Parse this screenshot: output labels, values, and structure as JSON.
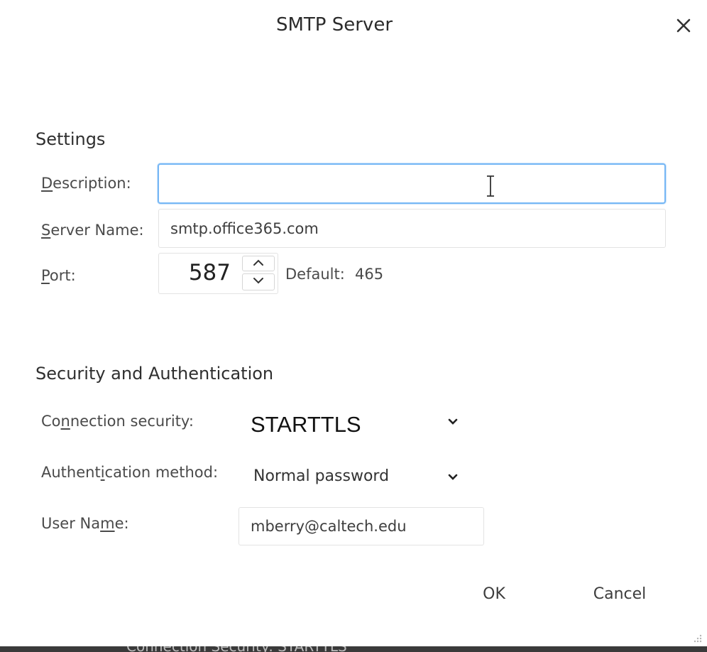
{
  "dialog": {
    "title": "SMTP Server",
    "close_icon": "close-icon"
  },
  "settings": {
    "heading": "Settings",
    "description": {
      "label_mnemonic": "D",
      "label_rest": "escription:",
      "value": ""
    },
    "server_name": {
      "label_mnemonic": "S",
      "label_rest": "erver Name:",
      "value": "smtp.office365.com"
    },
    "port": {
      "label_mnemonic": "P",
      "label_rest": "ort:",
      "value": "587",
      "default_label": "Default:",
      "default_value": "465"
    }
  },
  "security": {
    "heading": "Security and Authentication",
    "connection_security": {
      "label_pre": "Co",
      "label_mnemonic": "n",
      "label_post": "nection security:",
      "value": "STARTTLS"
    },
    "auth_method": {
      "label_pre": "Authent",
      "label_mnemonic": "i",
      "label_post": "cation method:",
      "value": "Normal password"
    },
    "user_name": {
      "label_pre": "User Na",
      "label_mnemonic": "m",
      "label_post": "e:",
      "value": "mberry@caltech.edu"
    }
  },
  "buttons": {
    "ok": "OK",
    "cancel": "Cancel"
  },
  "background_window": {
    "partial_text": "Connection Security:   STARTTLS"
  },
  "colors": {
    "focus_border": "#76b7f5",
    "text": "#3b3b3b",
    "field_border": "#e3e3e3"
  }
}
